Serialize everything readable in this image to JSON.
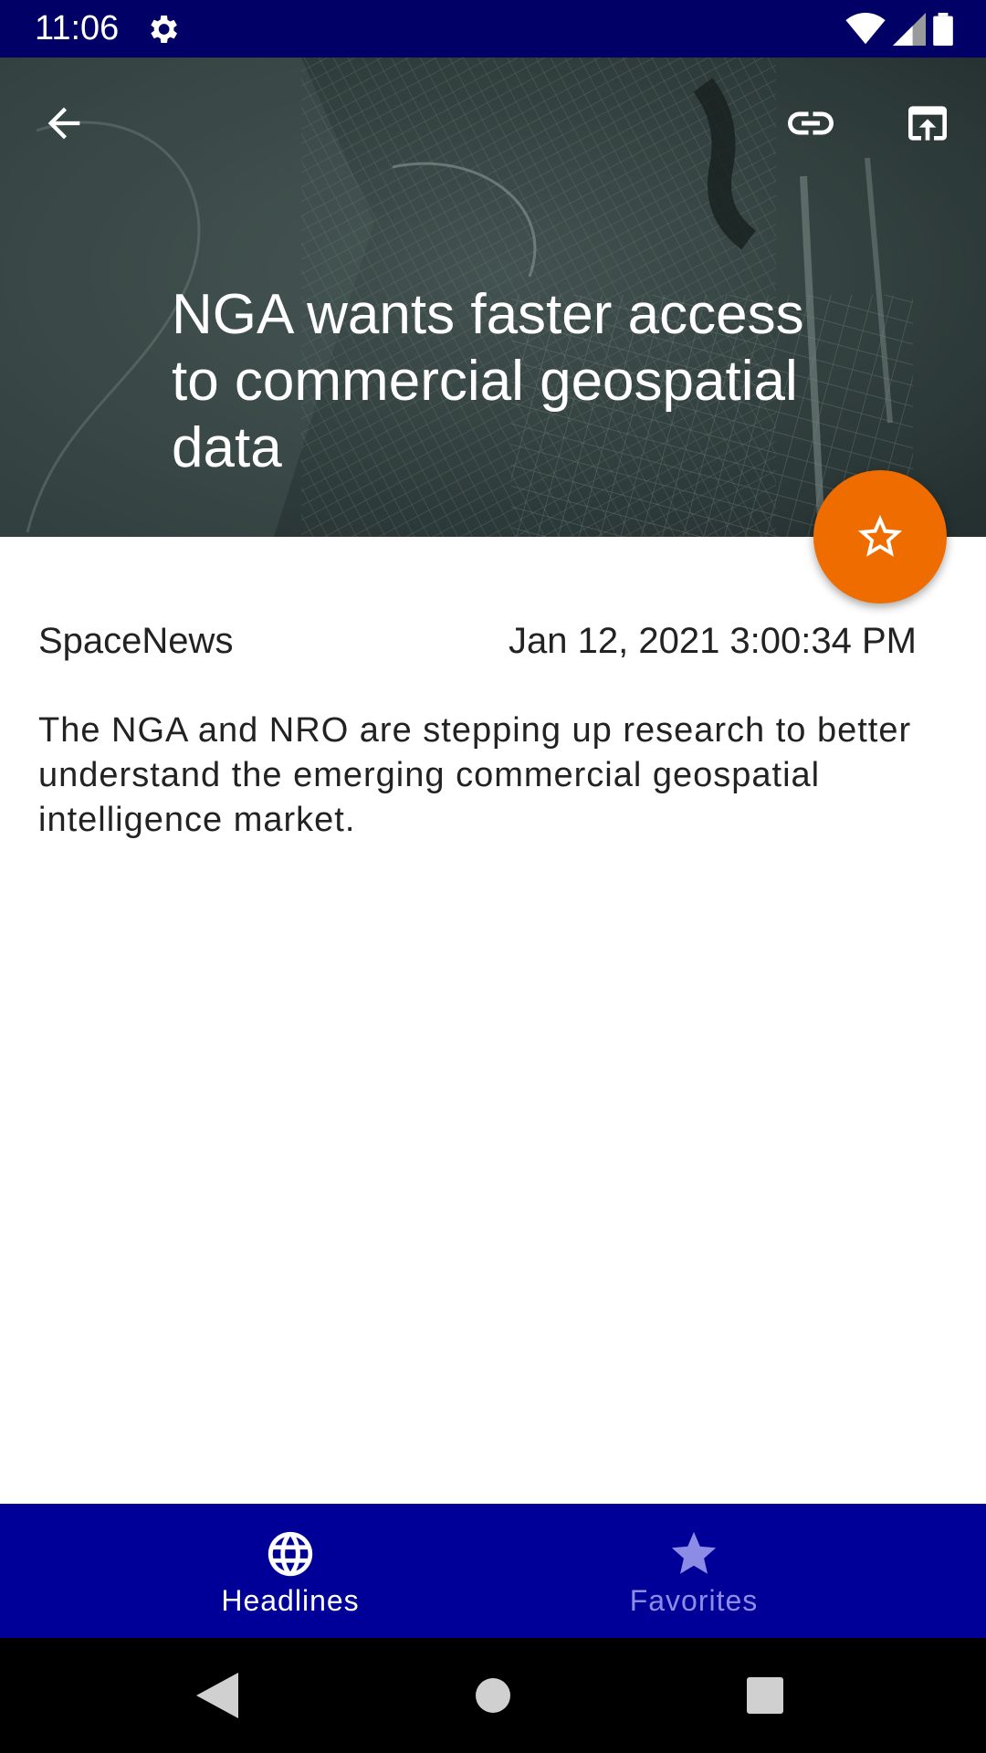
{
  "status_bar": {
    "time": "11:06",
    "icons": [
      "gear-icon",
      "wifi-icon",
      "signal-icon",
      "battery-icon"
    ]
  },
  "article": {
    "title": "NGA wants faster access to commercial geospatial data",
    "source": "SpaceNews",
    "date": "Jan 12, 2021 3:00:34 PM",
    "summary": "The NGA and NRO are stepping up research to better understand the emerging commercial geospatial intelligence market."
  },
  "toolbar": {
    "icons": [
      "arrow-back-icon",
      "link-icon",
      "open-in-browser-icon"
    ]
  },
  "fab": {
    "icon": "star-outline-icon",
    "color": "#ef6c00"
  },
  "bottom_nav": {
    "items": [
      {
        "label": "Headlines",
        "icon": "globe-icon",
        "selected": true
      },
      {
        "label": "Favorites",
        "icon": "star-icon",
        "selected": false
      }
    ],
    "background": "#000099"
  },
  "colors": {
    "status_bar": "#000066",
    "accent": "#ef6c00",
    "nav_inactive": "#8c8ce6"
  }
}
